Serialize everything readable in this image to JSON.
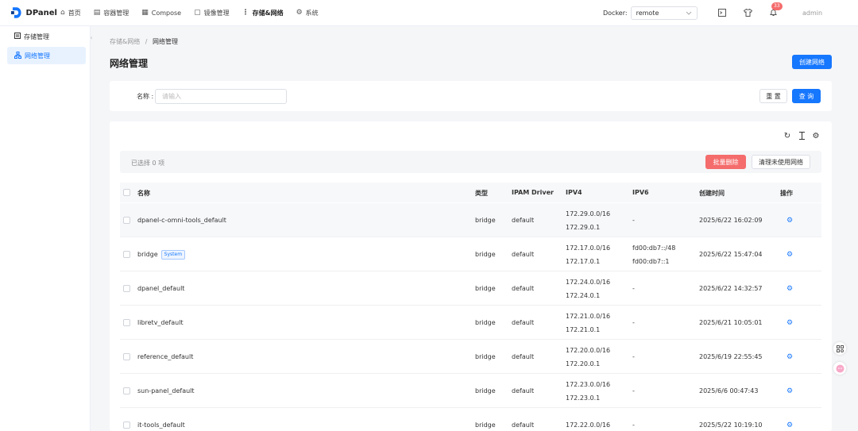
{
  "app": {
    "name": "DPanel"
  },
  "nav": [
    {
      "icon": "home-icon",
      "glyph": "⌂",
      "label": "首页"
    },
    {
      "icon": "container-icon",
      "glyph": "▤",
      "label": "容器管理"
    },
    {
      "icon": "compose-icon",
      "glyph": "▦",
      "label": "Compose"
    },
    {
      "icon": "image-icon",
      "glyph": "▢",
      "label": "镜像管理"
    },
    {
      "icon": "storage-icon",
      "glyph": "⋮",
      "label": "存储&网络"
    },
    {
      "icon": "gear-icon",
      "glyph": "⚙",
      "label": "系统"
    }
  ],
  "docker": {
    "label": "Docker:",
    "value": "remote"
  },
  "notifications": {
    "count": "33"
  },
  "user": {
    "name": "admin"
  },
  "sidebar": {
    "items": [
      {
        "label": "存储管理"
      },
      {
        "label": "网络管理"
      }
    ]
  },
  "breadcrumb": {
    "parent": "存储&网络",
    "separator": "/",
    "current": "网络管理"
  },
  "page": {
    "title": "网络管理",
    "create_button": "创建网络"
  },
  "search": {
    "label": "名称 :",
    "placeholder": "请输入",
    "value": "",
    "reset_button": "重 置",
    "query_button": "查 询"
  },
  "selection": {
    "text": "已选择  0  项",
    "batch_delete": "批量删除",
    "clean_unused": "清理未使用网络"
  },
  "table": {
    "columns": [
      "名称",
      "类型",
      "IPAM Driver",
      "IPV4",
      "IPV6",
      "创建时间",
      "操作"
    ],
    "rows": [
      {
        "name": "dpanel-c-omni-tools_default",
        "tag": "",
        "type": "bridge",
        "driver": "default",
        "ipv4": [
          "172.29.0.0/16",
          "172.29.0.1"
        ],
        "ipv6": [
          "-"
        ],
        "created": "2025/6/22 16:02:09"
      },
      {
        "name": "bridge",
        "tag": "System",
        "type": "bridge",
        "driver": "default",
        "ipv4": [
          "172.17.0.0/16",
          "172.17.0.1"
        ],
        "ipv6": [
          "fd00:db7::/48",
          "fd00:db7::1"
        ],
        "created": "2025/6/22 15:47:04"
      },
      {
        "name": "dpanel_default",
        "tag": "",
        "type": "bridge",
        "driver": "default",
        "ipv4": [
          "172.24.0.0/16",
          "172.24.0.1"
        ],
        "ipv6": [
          "-"
        ],
        "created": "2025/6/22 14:32:57"
      },
      {
        "name": "libretv_default",
        "tag": "",
        "type": "bridge",
        "driver": "default",
        "ipv4": [
          "172.21.0.0/16",
          "172.21.0.1"
        ],
        "ipv6": [
          "-"
        ],
        "created": "2025/6/21 10:05:01"
      },
      {
        "name": "reference_default",
        "tag": "",
        "type": "bridge",
        "driver": "default",
        "ipv4": [
          "172.20.0.0/16",
          "172.20.0.1"
        ],
        "ipv6": [
          "-"
        ],
        "created": "2025/6/19 22:55:45"
      },
      {
        "name": "sun-panel_default",
        "tag": "",
        "type": "bridge",
        "driver": "default",
        "ipv4": [
          "172.23.0.0/16",
          "172.23.0.1"
        ],
        "ipv6": [
          "-"
        ],
        "created": "2025/6/6 00:47:43"
      },
      {
        "name": "it-tools_default",
        "tag": "",
        "type": "bridge",
        "driver": "default",
        "ipv4": [
          "172.22.0.0/16"
        ],
        "ipv6": [
          "-"
        ],
        "created": "2025/5/22 10:19:10"
      }
    ]
  },
  "colors": {
    "primary": "#1677ff",
    "danger": "#f56c6c",
    "background": "#f5f6f8"
  }
}
